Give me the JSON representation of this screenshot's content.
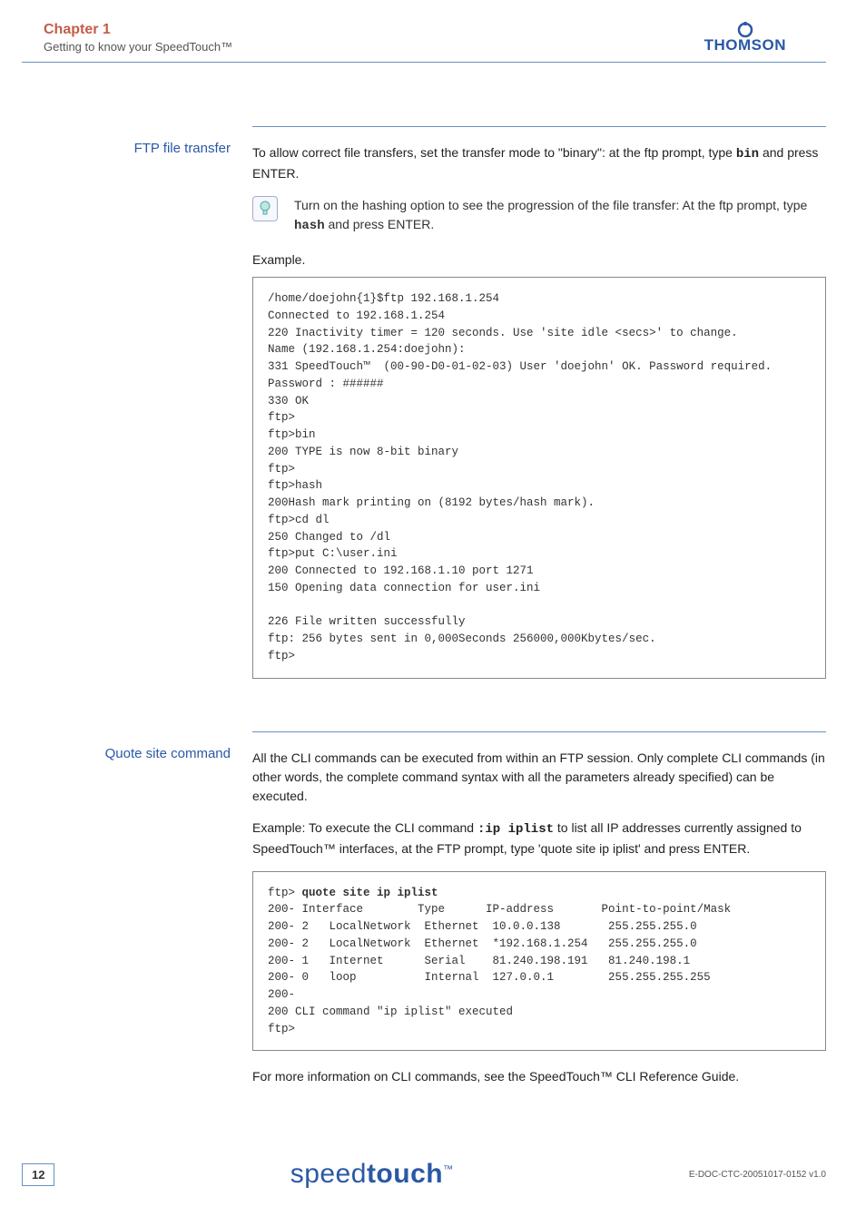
{
  "header": {
    "chapter": "Chapter 1",
    "subtitle": "Getting to know your SpeedTouch™",
    "brand": "THOMSON"
  },
  "section1": {
    "label": "FTP file transfer",
    "intro_pre": "To allow correct file transfers, set the transfer mode to \"binary\": at the ftp prompt, type ",
    "intro_cmd": "bin",
    "intro_post": " and press ENTER.",
    "tip_pre": "Turn on the hashing option to see the progression of the file transfer: At the ftp prompt, type ",
    "tip_cmd": "hash",
    "tip_post": " and press ENTER.",
    "example_label": "Example.",
    "code": "/home/doejohn{1}$ftp 192.168.1.254\nConnected to 192.168.1.254\n220 Inactivity timer = 120 seconds. Use 'site idle <secs>' to change.\nName (192.168.1.254:doejohn):\n331 SpeedTouch™  (00-90-D0-01-02-03) User 'doejohn' OK. Password required.\nPassword : ######\n330 OK\nftp>\nftp>bin\n200 TYPE is now 8-bit binary\nftp>\nftp>hash\n200Hash mark printing on (8192 bytes/hash mark).\nftp>cd dl\n250 Changed to /dl\nftp>put C:\\user.ini\n200 Connected to 192.168.1.10 port 1271\n150 Opening data connection for user.ini\n\n226 File written successfully\nftp: 256 bytes sent in 0,000Seconds 256000,000Kbytes/sec.\nftp>"
  },
  "section2": {
    "label": "Quote site command",
    "para1": "All the CLI commands can be executed from within an FTP session. Only complete CLI commands (in other words, the complete command syntax with all the parameters already specified) can be executed.",
    "para2_pre": "Example: To execute the CLI command ",
    "para2_cmd": ":ip iplist",
    "para2_post": " to list all IP addresses currently assigned to SpeedTouch™ interfaces, at the FTP prompt, type 'quote site ip iplist' and press ENTER.",
    "code_prefix": "ftp> ",
    "code_bold": "quote site ip iplist",
    "code_rest": "\n200- Interface        Type      IP-address       Point-to-point/Mask\n200- 2   LocalNetwork  Ethernet  10.0.0.138       255.255.255.0\n200- 2   LocalNetwork  Ethernet  *192.168.1.254   255.255.255.0\n200- 1   Internet      Serial    81.240.198.191   81.240.198.1\n200- 0   loop          Internal  127.0.0.1        255.255.255.255\n200-\n200 CLI command \"ip iplist\" executed\nftp>",
    "para3": "For more information on CLI commands, see the SpeedTouch™ CLI Reference Guide."
  },
  "footer": {
    "page": "12",
    "logo_light": "speed",
    "logo_bold": "touch",
    "logo_tm": "™",
    "docid": "E-DOC-CTC-20051017-0152 v1.0"
  }
}
